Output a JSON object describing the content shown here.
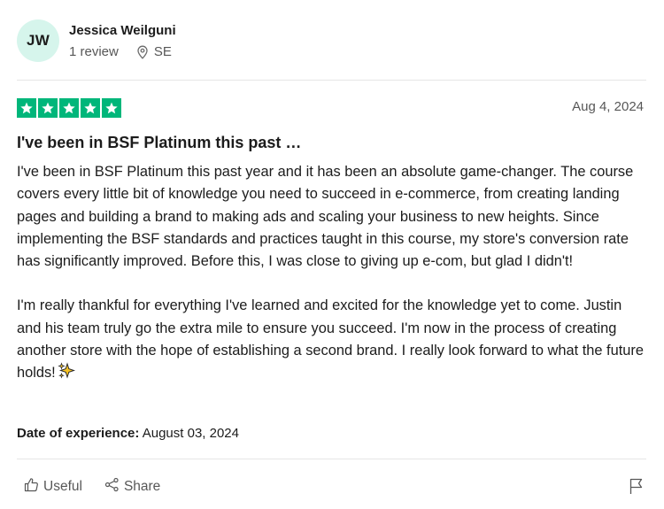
{
  "reviewer": {
    "initials": "JW",
    "name": "Jessica Weilguni",
    "review_count": "1 review",
    "country": "SE"
  },
  "review": {
    "rating": 5,
    "rating_max": 5,
    "date": "Aug 4, 2024",
    "title": "I've been in BSF Platinum this past …",
    "paragraph_1": "I've been in BSF Platinum this past year and it has been an absolute game-changer. The course covers every little bit of knowledge you need to succeed in e-commerce, from creating landing pages and building a brand to making ads and scaling your business to new heights. Since implementing the BSF standards and practices taught in this course, my store's conversion rate has significantly improved. Before this, I was close to giving up e-com, but glad I didn't!",
    "paragraph_2": "I'm really thankful for everything I've learned and excited for the knowledge yet to come. Justin and his team truly go the extra mile to ensure you succeed. I'm now in the process of creating another store with the hope of establishing a second brand. I really look forward to what the future holds!",
    "paragraph_2_emoji": "sparkles-icon",
    "experience_label": "Date of experience:",
    "experience_date": "August 03, 2024"
  },
  "actions": {
    "useful_label": "Useful",
    "share_label": "Share",
    "flag_icon": "flag-icon"
  },
  "colors": {
    "star_green": "#00b67a",
    "avatar_bg": "#d6f5ec",
    "muted_text": "#575757"
  }
}
